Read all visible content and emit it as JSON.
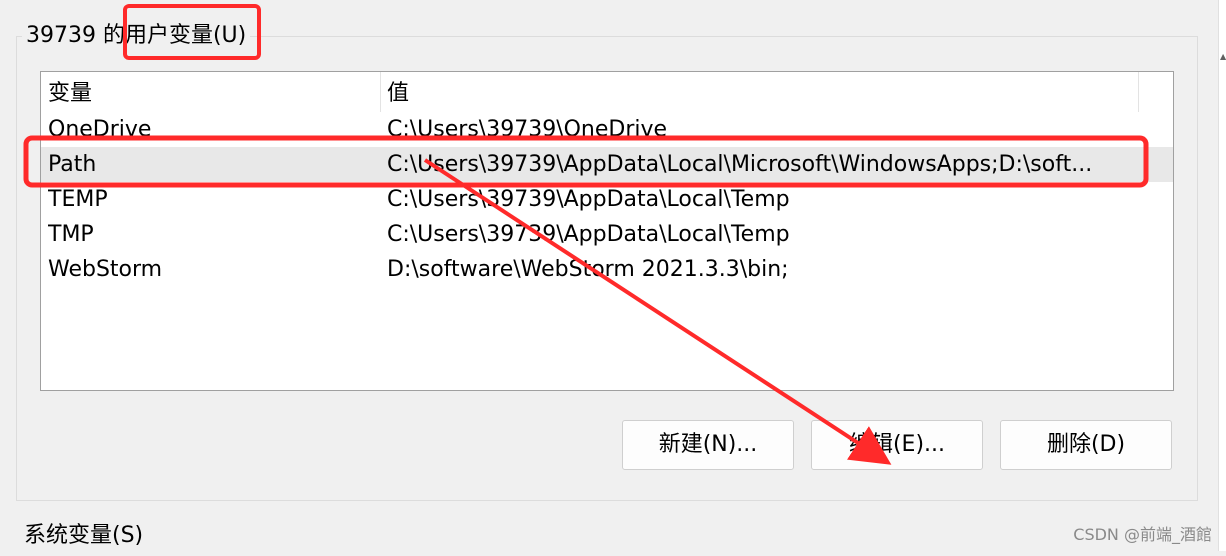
{
  "user_vars": {
    "group_label": "39739 的用户变量(U)",
    "columns": {
      "name": "变量",
      "value": "值"
    },
    "rows": [
      {
        "name": "OneDrive",
        "value": "C:\\Users\\39739\\OneDrive"
      },
      {
        "name": "Path",
        "value": "C:\\Users\\39739\\AppData\\Local\\Microsoft\\WindowsApps;D:\\soft..."
      },
      {
        "name": "TEMP",
        "value": "C:\\Users\\39739\\AppData\\Local\\Temp"
      },
      {
        "name": "TMP",
        "value": "C:\\Users\\39739\\AppData\\Local\\Temp"
      },
      {
        "name": "WebStorm",
        "value": "D:\\software\\WebStorm 2021.3.3\\bin;"
      }
    ],
    "selected_row": "Path",
    "buttons": {
      "new": "新建(N)...",
      "edit": "编辑(E)...",
      "delete": "删除(D)"
    }
  },
  "system_vars": {
    "label": "系统变量(S)"
  },
  "watermark": "CSDN @前端_酒館",
  "annotation_color": "#ff2a2a"
}
